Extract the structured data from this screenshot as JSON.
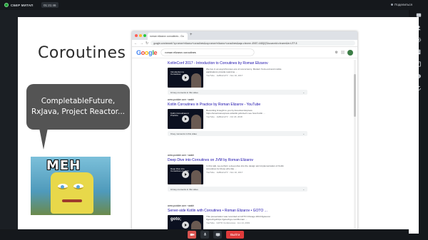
{
  "topbar": {
    "app_title": "СБЕР МИТАП",
    "timer": "01:21:46",
    "share_label": "Поделиться"
  },
  "slide": {
    "title": "Coroutines",
    "bubble_line1": "CompletableFuture,",
    "bubble_line2": "RxJava, Project Reactor...",
    "meme_text": "MEH"
  },
  "browser": {
    "tab_title": "roman elizarov coroutines - Go",
    "address": "google.com/search?q=roman+elizarov+coroutines&oq=roman+elizarov+coroutines&aqs=chrome..69i57.4463j0j7&sourceid=chrome&ie=UTF-8",
    "logo": "Google",
    "query": "roman elizarov coroutines"
  },
  "results": [
    {
      "url": "",
      "title": "KotlinConf 2017 - Introduction to Coroutines by Roman Elizarov",
      "thumb_text": "Introduction to Coroutines",
      "duration": "",
      "desc": "We live in an asynchronous era of concurrency. Modern front-end and mobile applications provide real-time ...",
      "meta": "YouTube · JetBrainsTV · Nov 10, 2017",
      "moments": "10 key moments in this video"
    },
    {
      "url": "www.youtube.com › watch",
      "title": "Kotlin Coroutines in Practice by Roman Elizarov - YouTube",
      "thumb_text": "Kotlin Coroutines in Practice",
      "duration": "",
      "desc": "Recording brought to you by American Express https://americanexpress.io/kotlin-jobs/Let's see how Kotlin ...",
      "meta": "YouTube · JetBrainsTV · Oct 18, 2018",
      "moments": "9 key moments in this video"
    },
    {
      "url": "www.youtube.com › watch",
      "title": "Deep Dive into Coroutines on JVM by Roman Elizarov",
      "thumb_text": "Deep Dive into Coroutines on JVM",
      "duration": "",
      "desc": "In this talk, we perform a deep dive into the design and implementation of Kotlin coroutines for those who like ...",
      "meta": "YouTube · JetBrainsTV · Nov 10, 2017",
      "moments": "10 key moments in this video"
    },
    {
      "url": "www.youtube.com › watch",
      "title": "Server-side Kotlin with Coroutines • Roman Elizarov • GOTO ...",
      "thumb_text": "goto;",
      "duration": "",
      "desc": "This presentation was recorded at GOTO Chicago 2019 #gotocon #gotochgohttps://gotochgo.com/Roman ...",
      "meta": "YouTube · GOTO Conferences · Jun 14, 2019",
      "moments": ""
    }
  ],
  "bottombar": {
    "leave_label": "Выйти"
  },
  "colors": {
    "accent": "#21a038",
    "leave": "#e03b3b",
    "link": "#1a0dab"
  }
}
